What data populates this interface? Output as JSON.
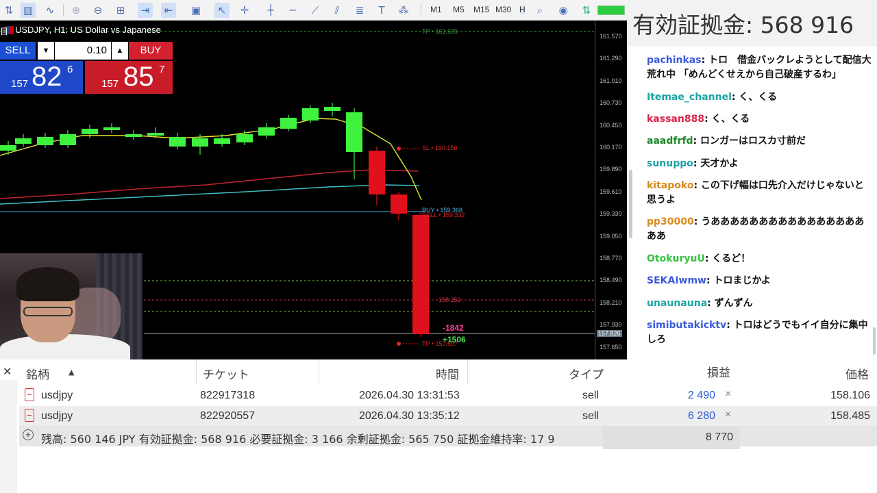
{
  "toolbar": {
    "timeframes": [
      "M1",
      "M5",
      "M15",
      "M30"
    ],
    "timeframe_active_prefix": "H"
  },
  "chart": {
    "title": "USDJPY, H1:  US Dollar vs Japanese",
    "logo_glyph": "目",
    "trade_panel": {
      "sell_label": "SELL",
      "buy_label": "BUY",
      "lot": "0.10",
      "down_arrow": "▼",
      "up_arrow": "▲",
      "sell_small": "157",
      "sell_big": "82",
      "sell_sup": "6",
      "buy_small": "157",
      "buy_big": "85",
      "buy_sup": "7"
    },
    "price_axis": [
      "161.570",
      "161.290",
      "161.010",
      "160.730",
      "160.450",
      "160.170",
      "159.890",
      "159.610",
      "159.330",
      "159.050",
      "158.770",
      "158.490",
      "158.210",
      "157.930",
      "157.650"
    ],
    "current_price_label": "157.826",
    "line_labels": {
      "tp_top": "TP • 161.599",
      "sl": "SL • 160.150",
      "buy": "BUY • 159.368",
      "sell": "SELL • 159.332",
      "mid": "158.252",
      "tp_bottom": "TP • 157.697"
    },
    "pnl": {
      "loss": "-1842",
      "gain": "+1506"
    }
  },
  "overlay": {
    "margin_banner": "有効証拠金: 568 916"
  },
  "chat": [
    {
      "user": "pachinkas",
      "color": "#3b5bdb",
      "text": "トロ　借金バックレようとして配信大荒れ中 「めんどくせえから自己破産するわ」"
    },
    {
      "user": "Itemae_channel",
      "color": "#1aa3a3",
      "text": "く、くる"
    },
    {
      "user": "kassan888",
      "color": "#d9234a",
      "text": "く、くる"
    },
    {
      "user": "aaadfrfd",
      "color": "#1f8a2a",
      "text": "ロンガーはロスカ寸前だ"
    },
    {
      "user": "sunuppo",
      "color": "#1aa3a3",
      "text": "天才かよ"
    },
    {
      "user": "kitapoko",
      "color": "#d98a1a",
      "text": "この下げ幅は口先介入だけじゃないと思うよ"
    },
    {
      "user": "pp30000",
      "color": "#d98a1a",
      "text": "うああああああああああああああああああ"
    },
    {
      "user": "OtokuryuU",
      "color": "#35c43f",
      "text": "くるど！"
    },
    {
      "user": "SEKAIwmw",
      "color": "#3b5bdb",
      "text": "トロまじかよ"
    },
    {
      "user": "unaunauna",
      "color": "#1aa3a3",
      "text": "ずんずん"
    },
    {
      "user": "simibutakicktv",
      "color": "#3b5bdb",
      "text": "トロはどうでもイイ自分に集中しろ"
    }
  ],
  "positions": {
    "headers": [
      "銘柄",
      "チケット",
      "時間",
      "タイプ",
      "損益",
      "価格"
    ],
    "rows": [
      {
        "symbol": "usdjpy",
        "ticket": "822917318",
        "time": "2026.04.30 13:31:53",
        "type": "sell",
        "profit": "2 490",
        "price": "158.106"
      },
      {
        "symbol": "usdjpy",
        "ticket": "822920557",
        "time": "2026.04.30 13:35:12",
        "type": "sell",
        "profit": "6 280",
        "price": "158.485"
      }
    ],
    "summary": "残高: 560 146 JPY  有効証拠金: 568 916  必要証拠金: 3 166  余剰証拠金: 565 750  証拠金維持率: 17 9",
    "total": "8 770",
    "close_glyph": "×",
    "sort_glyph": "▲",
    "plus_glyph": "+",
    "panel_close_glyph": "✕"
  }
}
